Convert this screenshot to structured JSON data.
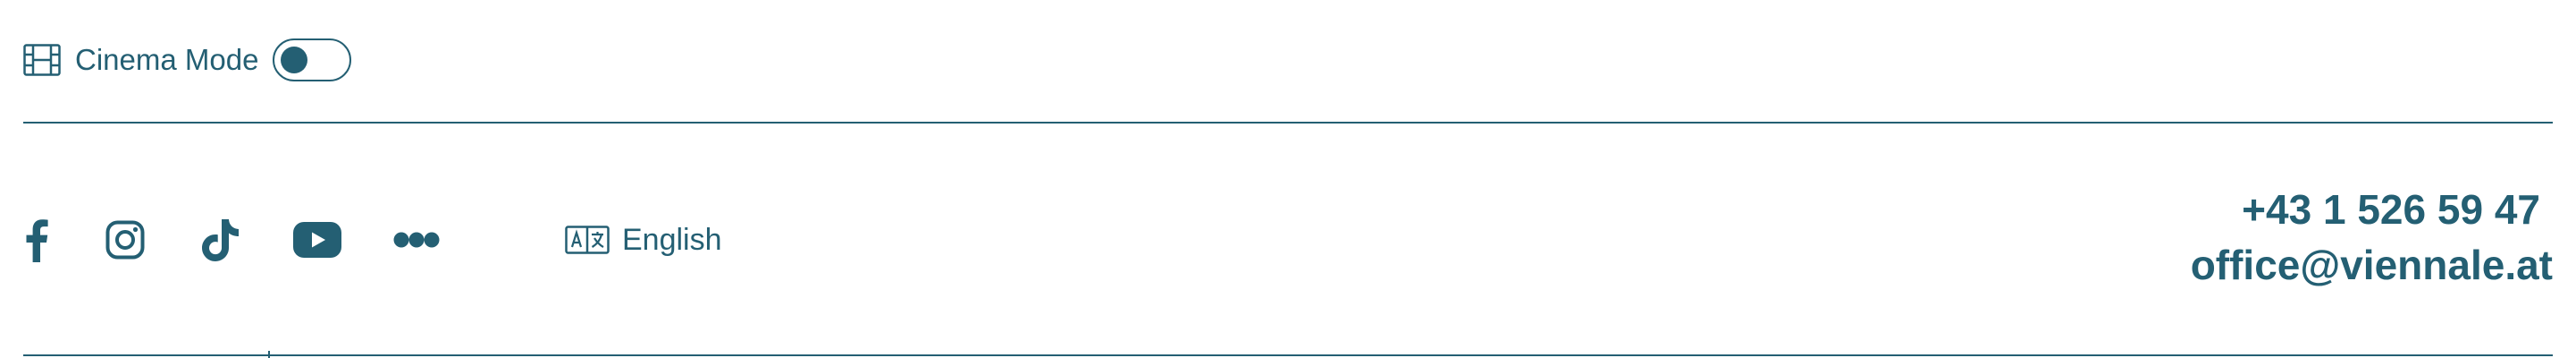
{
  "cinema_mode": {
    "icon": "film-icon",
    "label": "Cinema Mode",
    "enabled": false
  },
  "social": [
    {
      "name": "Facebook",
      "icon": "facebook-icon"
    },
    {
      "name": "Instagram",
      "icon": "instagram-icon"
    },
    {
      "name": "TikTok",
      "icon": "tiktok-icon"
    },
    {
      "name": "YouTube",
      "icon": "youtube-icon"
    },
    {
      "name": "Flickr",
      "icon": "flickr-icon"
    }
  ],
  "language": {
    "icon": "translate-icon",
    "label": "English"
  },
  "contact": {
    "phone": "+43 1 526 59 47",
    "email": "office@viennale.at"
  },
  "colors": {
    "primary": "#245f73",
    "background": "#ffffff"
  }
}
